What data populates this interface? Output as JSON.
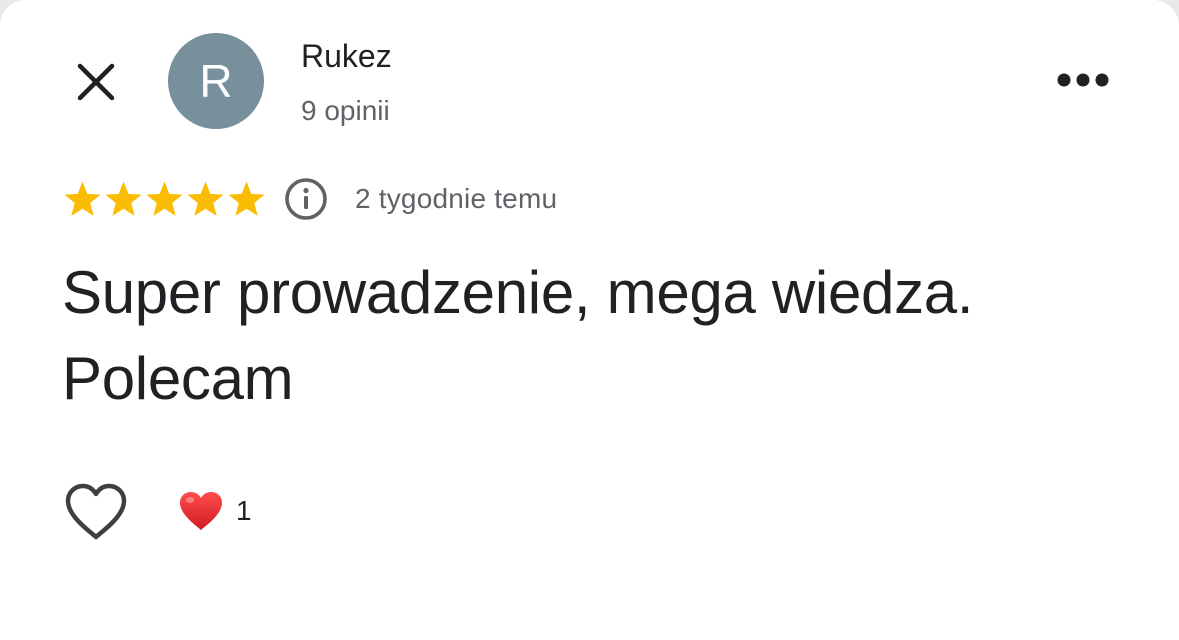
{
  "author": {
    "initial": "R",
    "name": "Rukez",
    "review_count": "9 opinii",
    "avatar_color": "#78909c"
  },
  "review": {
    "rating": 5,
    "rating_max": 5,
    "star_color": "#fbbc04",
    "date": "2 tygodnie temu",
    "text": "Super prowadzenie, mega wiedza. Polecam"
  },
  "reactions": {
    "like_icon": "heart-outline-icon",
    "reaction_icon": "red-heart-emoji",
    "reaction_color": "#e0242b",
    "count": "1"
  },
  "icons": {
    "close": "close-icon",
    "more": "more-horizontal-icon",
    "info": "info-icon",
    "star": "star-icon"
  }
}
